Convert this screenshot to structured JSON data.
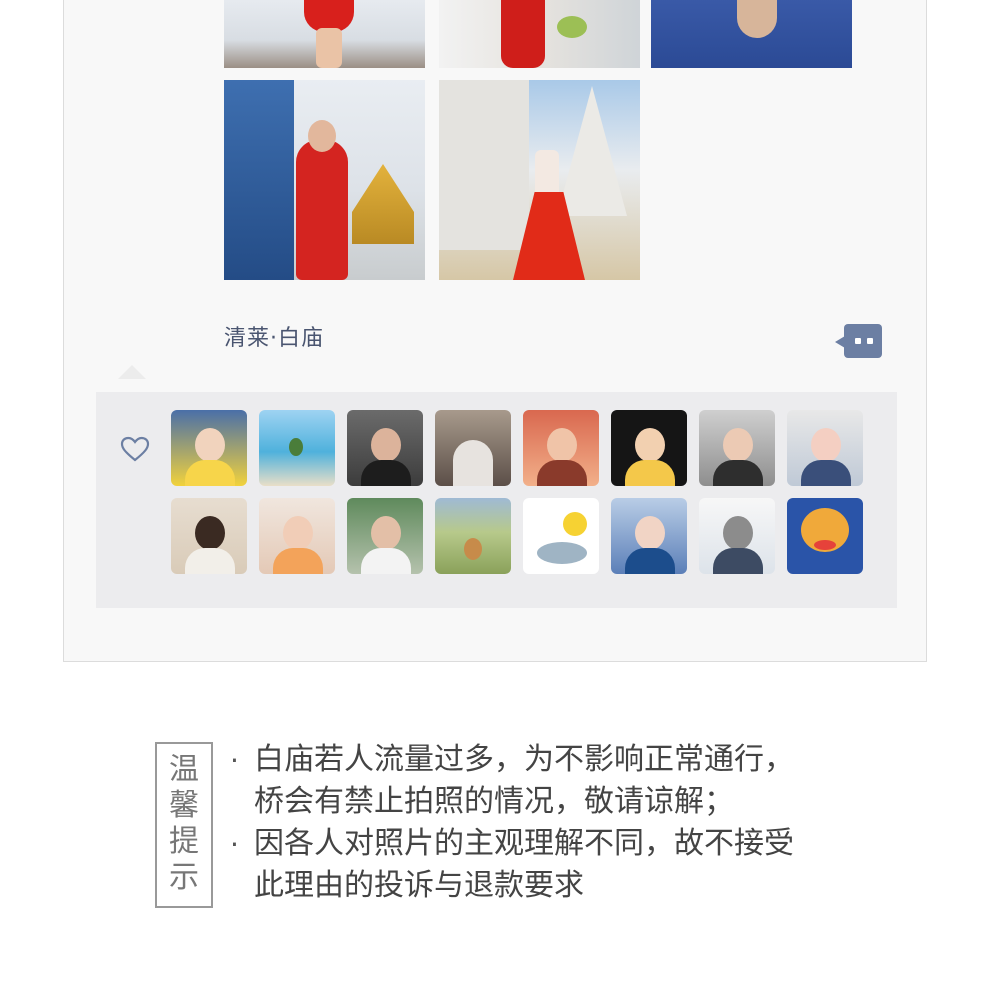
{
  "post": {
    "location_text": "清莱·白庙",
    "photos": [
      {
        "name": "photo-1"
      },
      {
        "name": "photo-2"
      },
      {
        "name": "photo-3"
      },
      {
        "name": "photo-4"
      },
      {
        "name": "photo-5"
      }
    ],
    "comment_icon": "comment-bubble-icon",
    "like_icon": "heart-icon",
    "liked_avatars_count": 16
  },
  "colors": {
    "location_text": "#4a5570",
    "comment_button": "#6c7fa3",
    "likes_panel_bg": "#ececee",
    "card_bg": "#f8f8f8"
  },
  "tips": {
    "title": "温馨提示",
    "items": [
      {
        "bullet": "·",
        "lines": [
          "白庙若人流量过多，为不影响正常通行，",
          "桥会有禁止拍照的情况，敬请谅解；"
        ]
      },
      {
        "bullet": "·",
        "lines": [
          "因各人对照片的主观理解不同，故不接受",
          "此理由的投诉与退款要求"
        ]
      }
    ]
  }
}
